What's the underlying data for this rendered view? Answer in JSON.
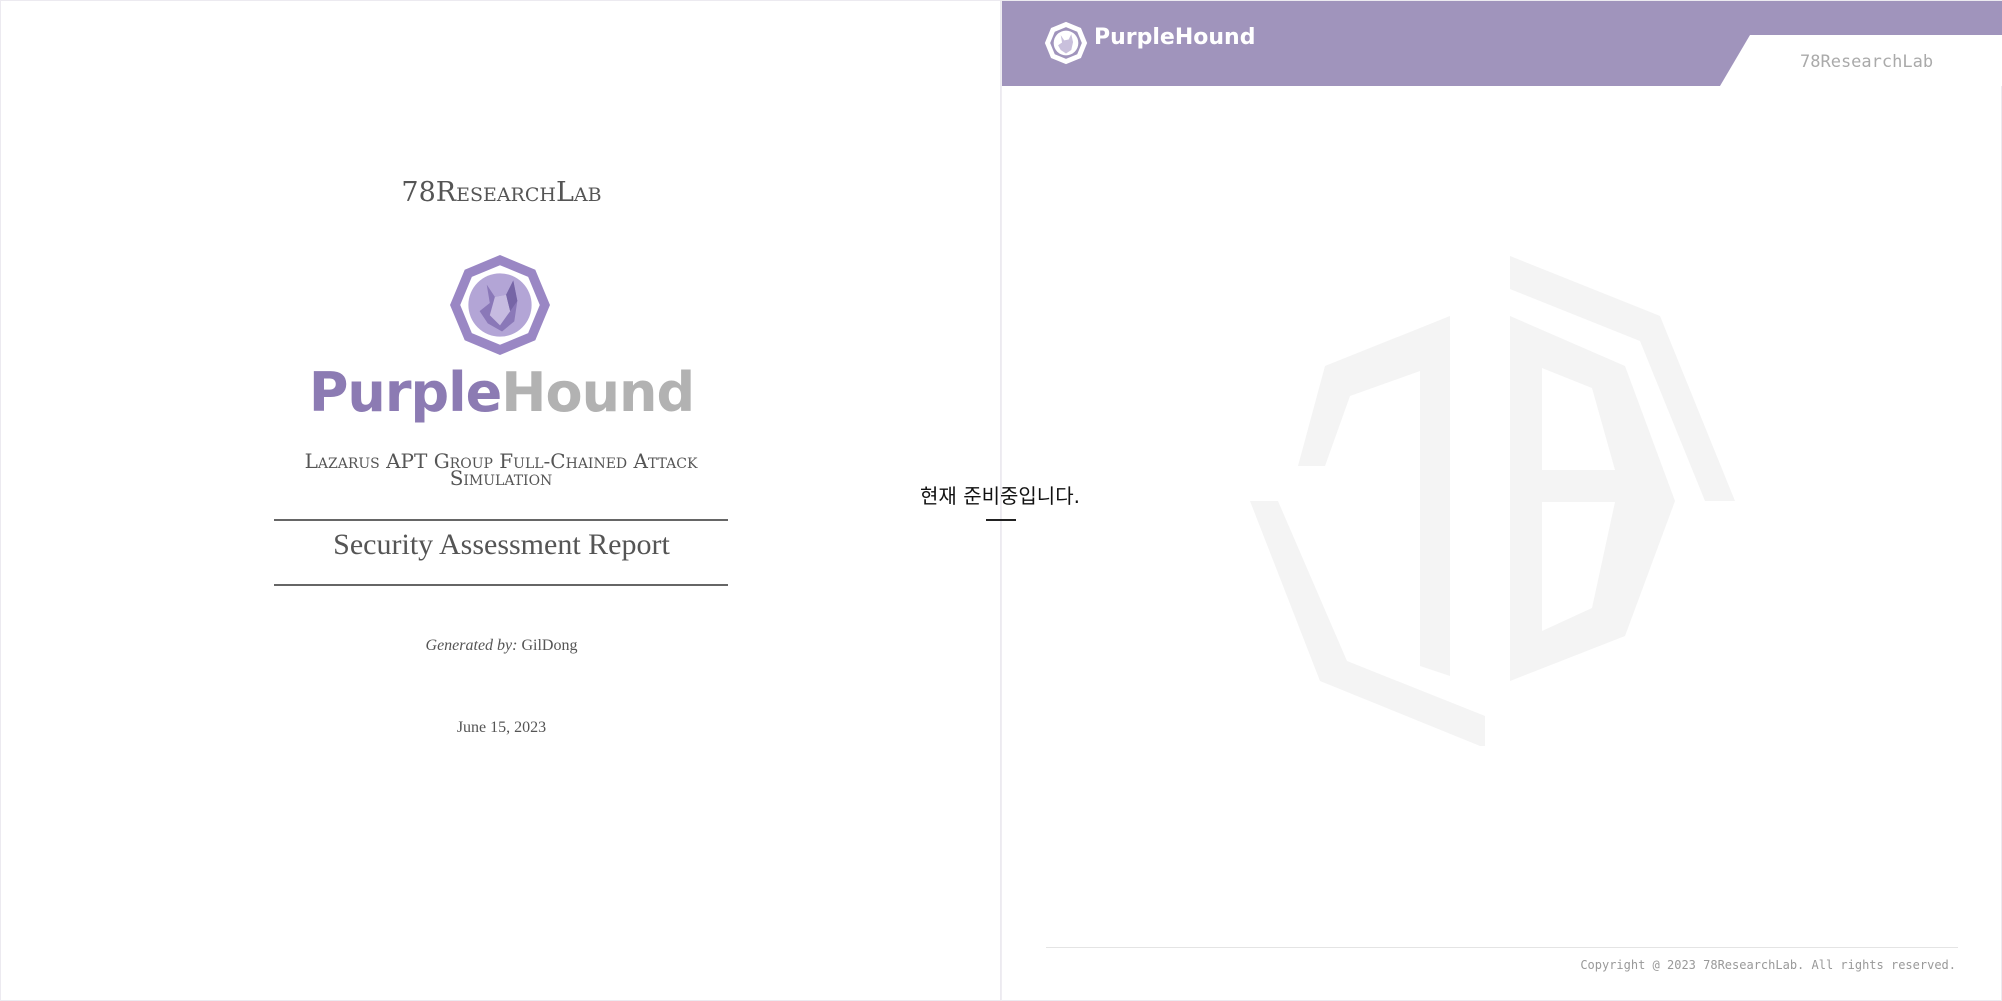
{
  "cover": {
    "lab_name": "78ResearchLab",
    "brand_part1": "Purple",
    "brand_part2": "Hound",
    "subtitle": "Lazarus APT Group Full-Chained Attack Simulation",
    "report_title": "Security Assessment Report",
    "generated_label": "Generated by:",
    "generated_by": "GilDong",
    "date": "June 15, 2023"
  },
  "notice": {
    "text": "현재 준비중입니다."
  },
  "header": {
    "brand": "PurpleHound",
    "tab_label": "78ResearchLab"
  },
  "footer": {
    "copyright": "Copyright @ 2023 78ResearchLab. All rights reserved."
  },
  "icons": {
    "emblem": "purplehound-emblem-icon",
    "header_logo": "purplehound-logo-icon",
    "watermark": "78-watermark-icon"
  },
  "colors": {
    "brand_purple": "#8c7bb3",
    "brand_gray": "#b2b2b2",
    "header_bar": "#a094bc",
    "text_dark": "#555555"
  }
}
